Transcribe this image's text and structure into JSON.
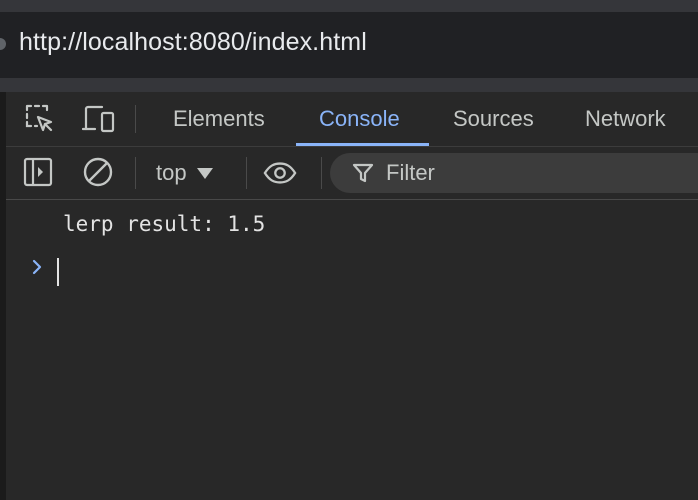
{
  "browser": {
    "url": "http://localhost:8080/index.html"
  },
  "devtools": {
    "tabs": [
      {
        "label": "Elements",
        "active": false
      },
      {
        "label": "Console",
        "active": true
      },
      {
        "label": "Sources",
        "active": false
      },
      {
        "label": "Network",
        "active": false
      }
    ],
    "toolbar_icons": [
      "inspect-element-icon",
      "device-toolbar-icon"
    ]
  },
  "console": {
    "toolbar": {
      "icons": [
        "sidebar-toggle-icon",
        "clear-console-icon",
        "eye-icon",
        "filter-icon"
      ],
      "context": "top",
      "filter_placeholder": "Filter"
    },
    "messages": [
      {
        "text": "lerp result: 1.5"
      }
    ],
    "prompt_value": ""
  },
  "colors": {
    "accent": "#8ab4f8",
    "background": "#282828",
    "text": "#c4c7c5"
  }
}
